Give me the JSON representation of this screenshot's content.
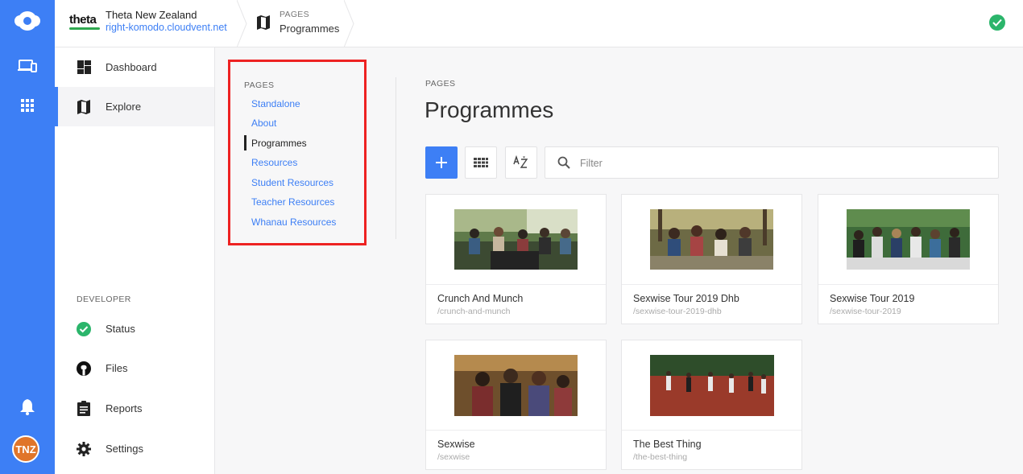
{
  "rail": {
    "items": [
      {
        "icon": "logo-icon"
      },
      {
        "icon": "devices-icon"
      },
      {
        "icon": "apps-grid-icon"
      },
      {
        "icon": "bell-icon"
      }
    ],
    "avatar_initials": "TNZ",
    "accent_color": "#3d7ff5"
  },
  "topbar": {
    "brand_logo_text": "theta",
    "site_name": "Theta New Zealand",
    "site_url": "right-komodo.cloudvent.net",
    "crumb_label": "PAGES",
    "crumb_value": "Programmes",
    "status_icon": "check-circle-icon"
  },
  "sidebar": {
    "items": [
      {
        "label": "Dashboard",
        "icon": "dashboard-icon"
      },
      {
        "label": "Explore",
        "icon": "map-icon",
        "active": true
      }
    ],
    "developer_title": "DEVELOPER",
    "developer_items": [
      {
        "label": "Status",
        "icon": "check-circle-icon"
      },
      {
        "label": "Files",
        "icon": "github-icon"
      },
      {
        "label": "Reports",
        "icon": "clipboard-icon"
      },
      {
        "label": "Settings",
        "icon": "gear-icon"
      }
    ]
  },
  "tree": {
    "title": "PAGES",
    "items": [
      {
        "label": "Standalone"
      },
      {
        "label": "About"
      },
      {
        "label": "Programmes",
        "current": true
      },
      {
        "label": "Resources"
      },
      {
        "label": "Student Resources"
      },
      {
        "label": "Teacher Resources"
      },
      {
        "label": "Whanau Resources"
      }
    ]
  },
  "main": {
    "label": "PAGES",
    "title": "Programmes",
    "filter_placeholder": "Filter",
    "filter_value": "",
    "cards": [
      {
        "title": "Crunch And Munch",
        "slug": "/crunch-and-munch"
      },
      {
        "title": "Sexwise Tour 2019 Dhb",
        "slug": "/sexwise-tour-2019-dhb"
      },
      {
        "title": "Sexwise Tour 2019",
        "slug": "/sexwise-tour-2019"
      },
      {
        "title": "Sexwise",
        "slug": "/sexwise"
      },
      {
        "title": "The Best Thing",
        "slug": "/the-best-thing"
      }
    ]
  }
}
